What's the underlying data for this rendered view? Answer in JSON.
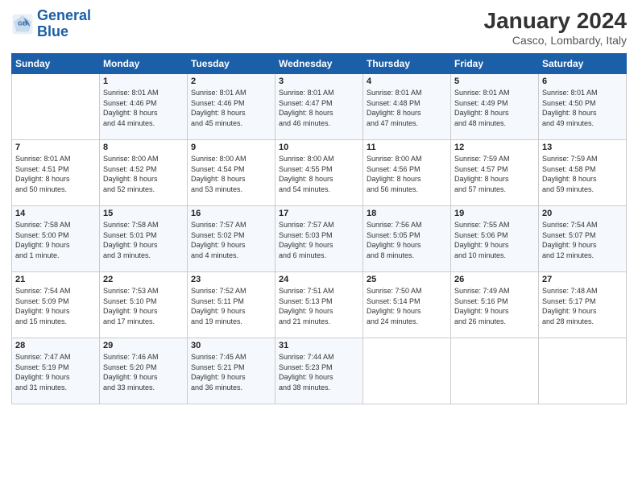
{
  "header": {
    "logo_text_general": "General",
    "logo_text_blue": "Blue",
    "month_title": "January 2024",
    "location": "Casco, Lombardy, Italy"
  },
  "days_of_week": [
    "Sunday",
    "Monday",
    "Tuesday",
    "Wednesday",
    "Thursday",
    "Friday",
    "Saturday"
  ],
  "weeks": [
    [
      {
        "day": "",
        "info": ""
      },
      {
        "day": "1",
        "info": "Sunrise: 8:01 AM\nSunset: 4:46 PM\nDaylight: 8 hours\nand 44 minutes."
      },
      {
        "day": "2",
        "info": "Sunrise: 8:01 AM\nSunset: 4:46 PM\nDaylight: 8 hours\nand 45 minutes."
      },
      {
        "day": "3",
        "info": "Sunrise: 8:01 AM\nSunset: 4:47 PM\nDaylight: 8 hours\nand 46 minutes."
      },
      {
        "day": "4",
        "info": "Sunrise: 8:01 AM\nSunset: 4:48 PM\nDaylight: 8 hours\nand 47 minutes."
      },
      {
        "day": "5",
        "info": "Sunrise: 8:01 AM\nSunset: 4:49 PM\nDaylight: 8 hours\nand 48 minutes."
      },
      {
        "day": "6",
        "info": "Sunrise: 8:01 AM\nSunset: 4:50 PM\nDaylight: 8 hours\nand 49 minutes."
      }
    ],
    [
      {
        "day": "7",
        "info": "Sunrise: 8:01 AM\nSunset: 4:51 PM\nDaylight: 8 hours\nand 50 minutes."
      },
      {
        "day": "8",
        "info": "Sunrise: 8:00 AM\nSunset: 4:52 PM\nDaylight: 8 hours\nand 52 minutes."
      },
      {
        "day": "9",
        "info": "Sunrise: 8:00 AM\nSunset: 4:54 PM\nDaylight: 8 hours\nand 53 minutes."
      },
      {
        "day": "10",
        "info": "Sunrise: 8:00 AM\nSunset: 4:55 PM\nDaylight: 8 hours\nand 54 minutes."
      },
      {
        "day": "11",
        "info": "Sunrise: 8:00 AM\nSunset: 4:56 PM\nDaylight: 8 hours\nand 56 minutes."
      },
      {
        "day": "12",
        "info": "Sunrise: 7:59 AM\nSunset: 4:57 PM\nDaylight: 8 hours\nand 57 minutes."
      },
      {
        "day": "13",
        "info": "Sunrise: 7:59 AM\nSunset: 4:58 PM\nDaylight: 8 hours\nand 59 minutes."
      }
    ],
    [
      {
        "day": "14",
        "info": "Sunrise: 7:58 AM\nSunset: 5:00 PM\nDaylight: 9 hours\nand 1 minute."
      },
      {
        "day": "15",
        "info": "Sunrise: 7:58 AM\nSunset: 5:01 PM\nDaylight: 9 hours\nand 3 minutes."
      },
      {
        "day": "16",
        "info": "Sunrise: 7:57 AM\nSunset: 5:02 PM\nDaylight: 9 hours\nand 4 minutes."
      },
      {
        "day": "17",
        "info": "Sunrise: 7:57 AM\nSunset: 5:03 PM\nDaylight: 9 hours\nand 6 minutes."
      },
      {
        "day": "18",
        "info": "Sunrise: 7:56 AM\nSunset: 5:05 PM\nDaylight: 9 hours\nand 8 minutes."
      },
      {
        "day": "19",
        "info": "Sunrise: 7:55 AM\nSunset: 5:06 PM\nDaylight: 9 hours\nand 10 minutes."
      },
      {
        "day": "20",
        "info": "Sunrise: 7:54 AM\nSunset: 5:07 PM\nDaylight: 9 hours\nand 12 minutes."
      }
    ],
    [
      {
        "day": "21",
        "info": "Sunrise: 7:54 AM\nSunset: 5:09 PM\nDaylight: 9 hours\nand 15 minutes."
      },
      {
        "day": "22",
        "info": "Sunrise: 7:53 AM\nSunset: 5:10 PM\nDaylight: 9 hours\nand 17 minutes."
      },
      {
        "day": "23",
        "info": "Sunrise: 7:52 AM\nSunset: 5:11 PM\nDaylight: 9 hours\nand 19 minutes."
      },
      {
        "day": "24",
        "info": "Sunrise: 7:51 AM\nSunset: 5:13 PM\nDaylight: 9 hours\nand 21 minutes."
      },
      {
        "day": "25",
        "info": "Sunrise: 7:50 AM\nSunset: 5:14 PM\nDaylight: 9 hours\nand 24 minutes."
      },
      {
        "day": "26",
        "info": "Sunrise: 7:49 AM\nSunset: 5:16 PM\nDaylight: 9 hours\nand 26 minutes."
      },
      {
        "day": "27",
        "info": "Sunrise: 7:48 AM\nSunset: 5:17 PM\nDaylight: 9 hours\nand 28 minutes."
      }
    ],
    [
      {
        "day": "28",
        "info": "Sunrise: 7:47 AM\nSunset: 5:19 PM\nDaylight: 9 hours\nand 31 minutes."
      },
      {
        "day": "29",
        "info": "Sunrise: 7:46 AM\nSunset: 5:20 PM\nDaylight: 9 hours\nand 33 minutes."
      },
      {
        "day": "30",
        "info": "Sunrise: 7:45 AM\nSunset: 5:21 PM\nDaylight: 9 hours\nand 36 minutes."
      },
      {
        "day": "31",
        "info": "Sunrise: 7:44 AM\nSunset: 5:23 PM\nDaylight: 9 hours\nand 38 minutes."
      },
      {
        "day": "",
        "info": ""
      },
      {
        "day": "",
        "info": ""
      },
      {
        "day": "",
        "info": ""
      }
    ]
  ]
}
